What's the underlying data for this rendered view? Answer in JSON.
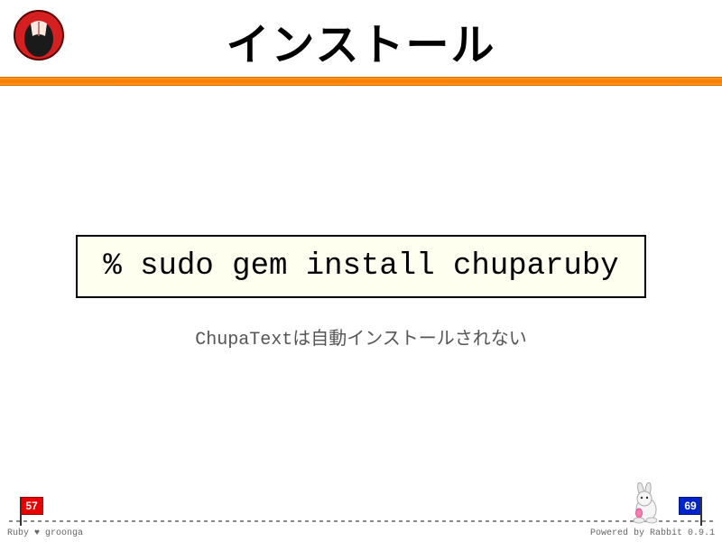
{
  "header": {
    "title": "インストール"
  },
  "main": {
    "command": "% sudo gem install chuparuby",
    "note": "ChupaTextは自動インストールされない"
  },
  "progress": {
    "current": "57",
    "total": "69"
  },
  "footer": {
    "left": "Ruby ♥ groonga",
    "right": "Powered by Rabbit 0.9.1"
  }
}
